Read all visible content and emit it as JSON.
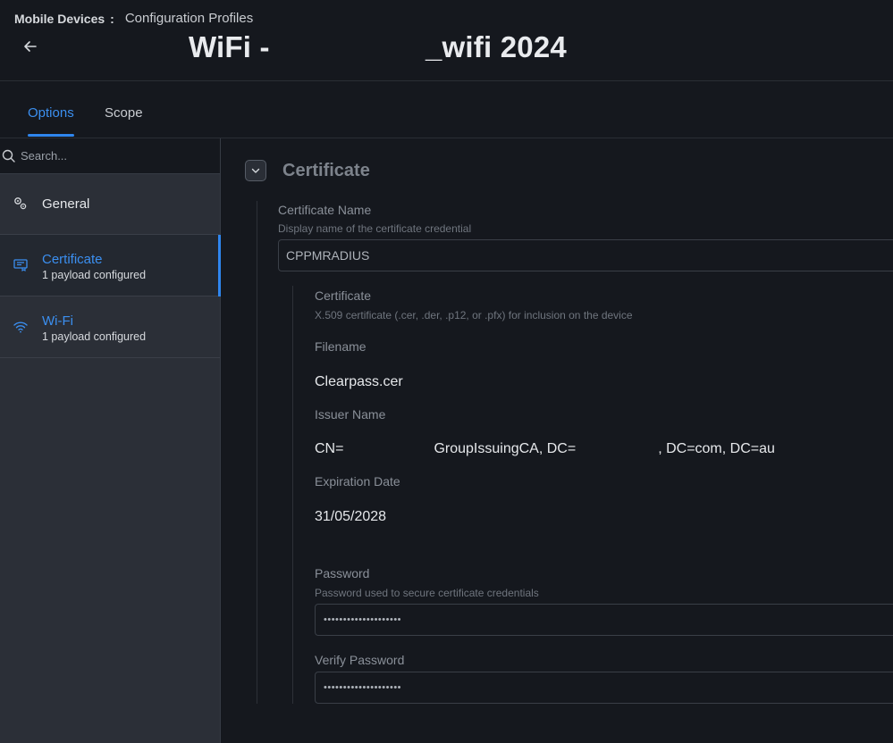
{
  "header": {
    "breadcrumb_root": "Mobile Devices",
    "breadcrumb_sep": ":",
    "breadcrumb_current": "Configuration Profiles",
    "title_part1": "WiFi -",
    "title_part2": "_wifi 2024"
  },
  "tabs": [
    {
      "label": "Options",
      "active": true
    },
    {
      "label": "Scope",
      "active": false
    }
  ],
  "search": {
    "placeholder": "Search..."
  },
  "sidebar": {
    "items": [
      {
        "label": "General",
        "icon": "gears-icon"
      },
      {
        "label": "Certificate",
        "sub": "1 payload configured",
        "icon": "certificate-icon",
        "active": true
      },
      {
        "label": "Wi-Fi",
        "sub": "1 payload configured",
        "icon": "wifi-icon"
      }
    ]
  },
  "main": {
    "section_title": "Certificate",
    "cert_name": {
      "label": "Certificate Name",
      "help": "Display name of the certificate credential",
      "value": "CPPMRADIUS"
    },
    "certificate": {
      "label": "Certificate",
      "help": "X.509 certificate (.cer, .der, .p12, or .pfx) for inclusion on the device"
    },
    "filename": {
      "label": "Filename",
      "value": "Clearpass.cer"
    },
    "issuer": {
      "label": "Issuer Name",
      "part1": "CN=",
      "part2": "GroupIssuingCA, DC=",
      "part3": ", DC=com, DC=au"
    },
    "expiration": {
      "label": "Expiration Date",
      "value": "31/05/2028"
    },
    "password": {
      "label": "Password",
      "help": "Password used to secure certificate credentials",
      "value": "••••••••••••••••••••"
    },
    "verify_password": {
      "label": "Verify Password",
      "value": "••••••••••••••••••••"
    }
  },
  "colors": {
    "accent": "#2f86ee",
    "background": "#15181e",
    "sidebar": "#2b2f37"
  }
}
